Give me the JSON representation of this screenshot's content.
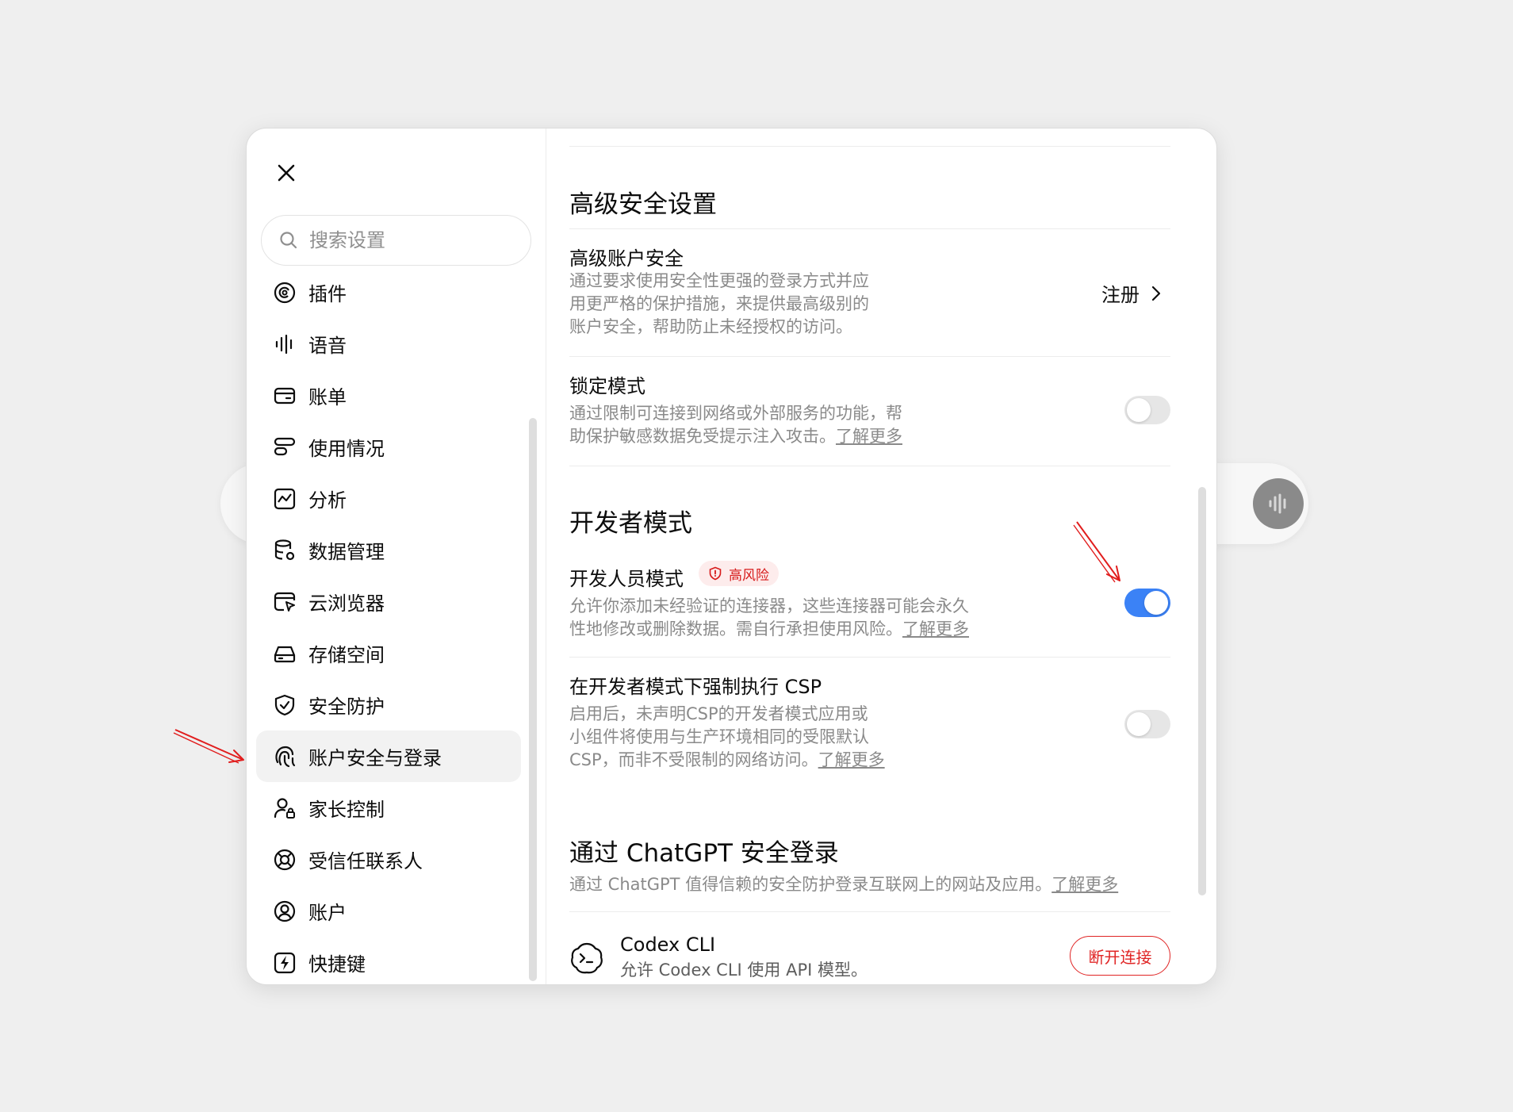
{
  "sidebar": {
    "search_placeholder": "搜索设置",
    "items": [
      {
        "label": "插件",
        "icon": "plugin-icon"
      },
      {
        "label": "语音",
        "icon": "voice-wave-icon"
      },
      {
        "label": "账单",
        "icon": "wallet-icon"
      },
      {
        "label": "使用情况",
        "icon": "usage-icon"
      },
      {
        "label": "分析",
        "icon": "analytics-icon"
      },
      {
        "label": "数据管理",
        "icon": "database-gear-icon"
      },
      {
        "label": "云浏览器",
        "icon": "cloud-browser-icon"
      },
      {
        "label": "存储空间",
        "icon": "storage-icon"
      },
      {
        "label": "安全防护",
        "icon": "shield-check-icon"
      },
      {
        "label": "账户安全与登录",
        "icon": "fingerprint-icon",
        "active": true
      },
      {
        "label": "家长控制",
        "icon": "parent-lock-icon"
      },
      {
        "label": "受信任联系人",
        "icon": "lifebuoy-icon"
      },
      {
        "label": "账户",
        "icon": "user-circle-icon"
      },
      {
        "label": "快捷键",
        "icon": "lightning-icon"
      }
    ]
  },
  "advanced": {
    "title": "高级安全设置",
    "account_security": {
      "title": "高级账户安全",
      "desc_lines": [
        "通过要求使用安全性更强的登录方式并应",
        "用更严格的保护措施，来提供最高级别的",
        "账户安全，帮助防止未经授权的访问。"
      ],
      "action": "注册"
    },
    "lockdown": {
      "title": "锁定模式",
      "desc_lines": [
        "通过限制可连接到网络或外部服务的功能，帮",
        "助保护敏感数据免受提示注入攻击。"
      ],
      "link": "了解更多",
      "enabled": false
    }
  },
  "developer": {
    "title": "开发者模式",
    "dev_mode": {
      "title": "开发人员模式",
      "badge": "高风险",
      "desc_lines": [
        "允许你添加未经验证的连接器，这些连接器可能会永久",
        "性地修改或删除数据。需自行承担使用风险。"
      ],
      "link": "了解更多",
      "enabled": true
    },
    "csp": {
      "title": "在开发者模式下强制执行 CSP",
      "desc_lines": [
        "启用后，未声明CSP的开发者模式应用或",
        "小组件将使用与生产环境相同的受限默认",
        "CSP，而非不受限制的网络访问。"
      ],
      "link": "了解更多",
      "enabled": false
    }
  },
  "chatgpt_login": {
    "title": "通过 ChatGPT 安全登录",
    "desc": "通过 ChatGPT 值得信赖的安全防护登录互联网上的网站及应用。",
    "link": "了解更多",
    "app": {
      "name": "Codex CLI",
      "desc": "允许 Codex CLI 使用 API 模型。",
      "action": "断开连接"
    }
  },
  "colors": {
    "accent": "#3b82f6",
    "danger": "#e02424",
    "annotation": "#e11d1d"
  }
}
